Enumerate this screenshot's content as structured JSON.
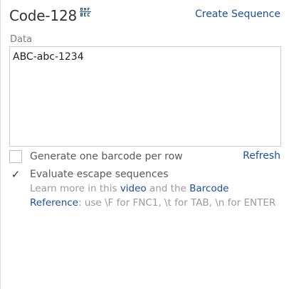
{
  "header": {
    "title": "Code-128",
    "icon": "qr-code-icon",
    "create_sequence_label": "Create Sequence"
  },
  "data_field": {
    "label": "Data",
    "value": "ABC-abc-1234"
  },
  "options": {
    "one_per_row_label": "Generate one barcode per row",
    "one_per_row_checked": false,
    "escape_label": "Evaluate escape sequences",
    "escape_checked": true,
    "refresh_label": "Refresh"
  },
  "help": {
    "prefix": "Learn more in this ",
    "video_link": "video",
    "middle": " and the ",
    "reference_link": "Barcode Reference",
    "suffix": ": use \\F for FNC1, \\t for TAB, \\n for ENTER"
  },
  "colors": {
    "link": "#1a4fa0",
    "text": "#333333",
    "muted": "#9a9a9a"
  }
}
